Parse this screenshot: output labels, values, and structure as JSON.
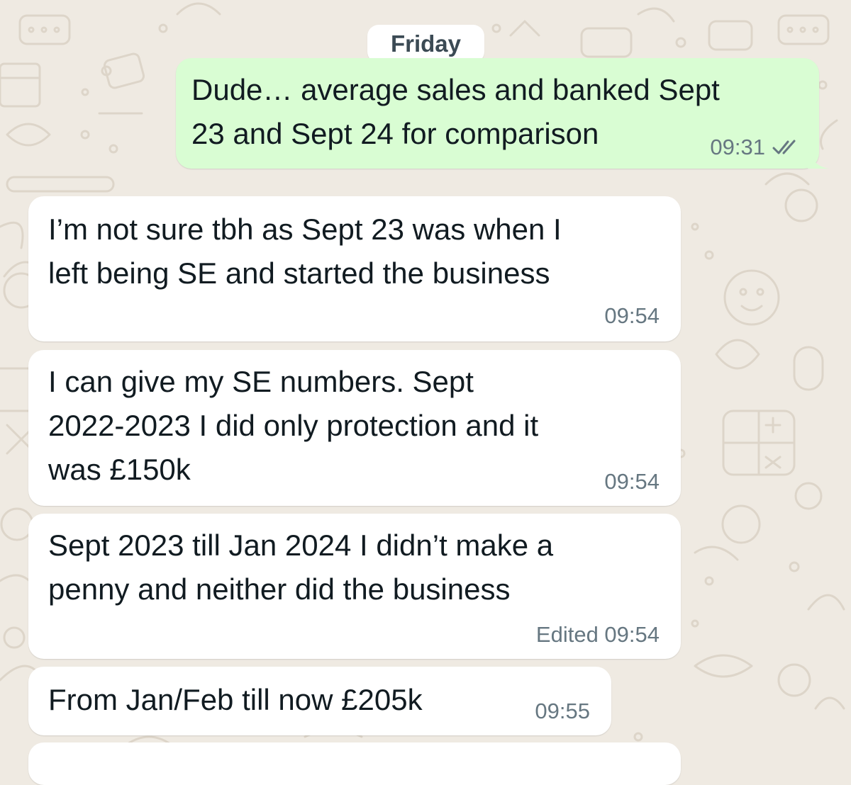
{
  "theme": {
    "wallpaper": "#efeae2",
    "outgoing_bubble": "#d9fdd3",
    "incoming_bubble": "#ffffff",
    "meta_text": "#667781",
    "read_tick": "#667781"
  },
  "date_separator": "Friday",
  "messages": [
    {
      "direction": "outgoing",
      "text": "Dude… average sales and banked Sept\n23 and Sept 24 for comparison",
      "time": "09:31",
      "status_icon": "double-check-icon"
    },
    {
      "direction": "incoming",
      "text": "I’m not sure tbh as Sept 23 was when I\nleft being SE and started the business",
      "time": "09:54"
    },
    {
      "direction": "incoming",
      "text": "I can give my SE numbers. Sept\n2022-2023 I did only protection and it\nwas £150k",
      "time": "09:54"
    },
    {
      "direction": "incoming",
      "text": "Sept 2023 till Jan 2024 I didn’t make a\npenny and neither did the business",
      "time": "Edited 09:54"
    },
    {
      "direction": "incoming",
      "text": "From Jan/Feb till now £205k",
      "time": "09:55"
    }
  ]
}
